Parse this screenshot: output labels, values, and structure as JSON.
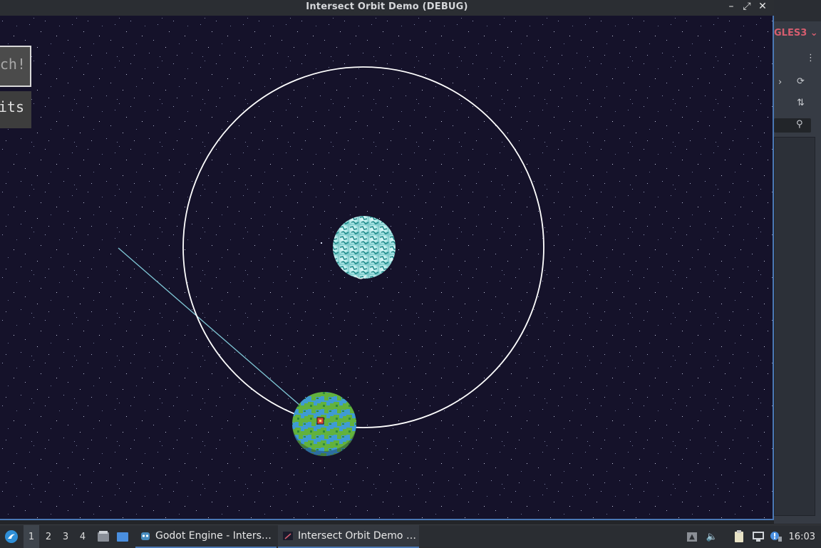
{
  "window": {
    "title": "Intersect Orbit Demo (DEBUG)",
    "minimize_icon": "minimize-icon",
    "maximize_icon": "maximize-icon",
    "close_icon": "close-icon"
  },
  "editor": {
    "renderer_label": "GLES3",
    "accent": "#d65d6f"
  },
  "game": {
    "button_launch_partial": "nch!",
    "button_credits_partial": "dits",
    "background": "#15122a",
    "orbit_color": "#ffffff",
    "trajectory_color": "#7fc7d6"
  },
  "taskbar": {
    "desktops": [
      "1",
      "2",
      "3",
      "4"
    ],
    "active_desktop": "1",
    "tasks": [
      {
        "label": "Godot Engine - Inters…",
        "icon": "godot-icon"
      },
      {
        "label": "Intersect Orbit Demo …",
        "icon": "game-window-icon"
      }
    ],
    "clock": "16:03"
  },
  "colors": {
    "accent_blue": "#4a78b5",
    "taskbar_bg": "#2a2d32"
  }
}
